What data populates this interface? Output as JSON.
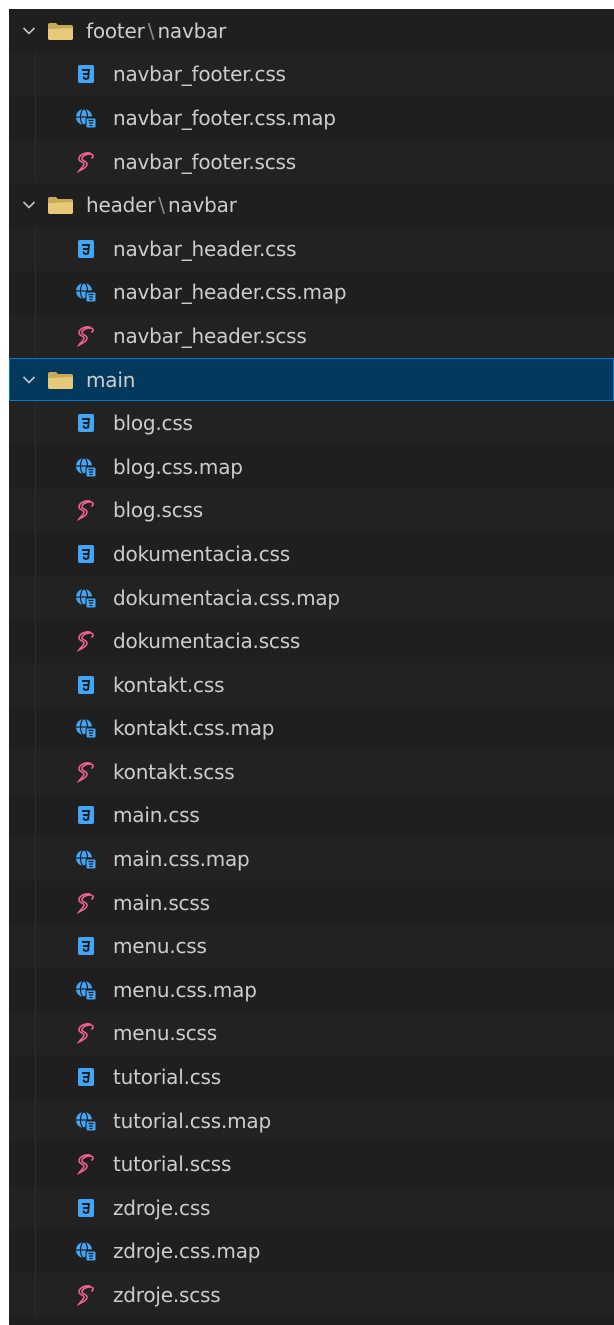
{
  "explorer": {
    "selected_folder": "main",
    "folders": [
      {
        "name": "footer",
        "sub": "navbar",
        "separator": "\\",
        "files": [
          {
            "name": "navbar_footer.css",
            "icon": "css3-icon"
          },
          {
            "name": "navbar_footer.css.map",
            "icon": "globe-css-map-icon"
          },
          {
            "name": "navbar_footer.scss",
            "icon": "sass-icon"
          }
        ]
      },
      {
        "name": "header",
        "sub": "navbar",
        "separator": "\\",
        "files": [
          {
            "name": "navbar_header.css",
            "icon": "css3-icon"
          },
          {
            "name": "navbar_header.css.map",
            "icon": "globe-css-map-icon"
          },
          {
            "name": "navbar_header.scss",
            "icon": "sass-icon"
          }
        ]
      },
      {
        "name": "main",
        "sub": "",
        "separator": "",
        "files": [
          {
            "name": "blog.css",
            "icon": "css3-icon"
          },
          {
            "name": "blog.css.map",
            "icon": "globe-css-map-icon"
          },
          {
            "name": "blog.scss",
            "icon": "sass-icon"
          },
          {
            "name": "dokumentacia.css",
            "icon": "css3-icon"
          },
          {
            "name": "dokumentacia.css.map",
            "icon": "globe-css-map-icon"
          },
          {
            "name": "dokumentacia.scss",
            "icon": "sass-icon"
          },
          {
            "name": "kontakt.css",
            "icon": "css3-icon"
          },
          {
            "name": "kontakt.css.map",
            "icon": "globe-css-map-icon"
          },
          {
            "name": "kontakt.scss",
            "icon": "sass-icon"
          },
          {
            "name": "main.css",
            "icon": "css3-icon"
          },
          {
            "name": "main.css.map",
            "icon": "globe-css-map-icon"
          },
          {
            "name": "main.scss",
            "icon": "sass-icon"
          },
          {
            "name": "menu.css",
            "icon": "css3-icon"
          },
          {
            "name": "menu.css.map",
            "icon": "globe-css-map-icon"
          },
          {
            "name": "menu.scss",
            "icon": "sass-icon"
          },
          {
            "name": "tutorial.css",
            "icon": "css3-icon"
          },
          {
            "name": "tutorial.css.map",
            "icon": "globe-css-map-icon"
          },
          {
            "name": "tutorial.scss",
            "icon": "sass-icon"
          },
          {
            "name": "zdroje.css",
            "icon": "css3-icon"
          },
          {
            "name": "zdroje.css.map",
            "icon": "globe-css-map-icon"
          },
          {
            "name": "zdroje.scss",
            "icon": "sass-icon"
          }
        ]
      }
    ]
  },
  "colors": {
    "background": "#1f1f1f",
    "text": "#cccccc",
    "selection": "#04395e",
    "selection_border": "#0078d4",
    "folder": "#e8c97a",
    "css": "#42a5f5",
    "css_map_globe": "#42a5f5",
    "sass": "#f06292"
  }
}
